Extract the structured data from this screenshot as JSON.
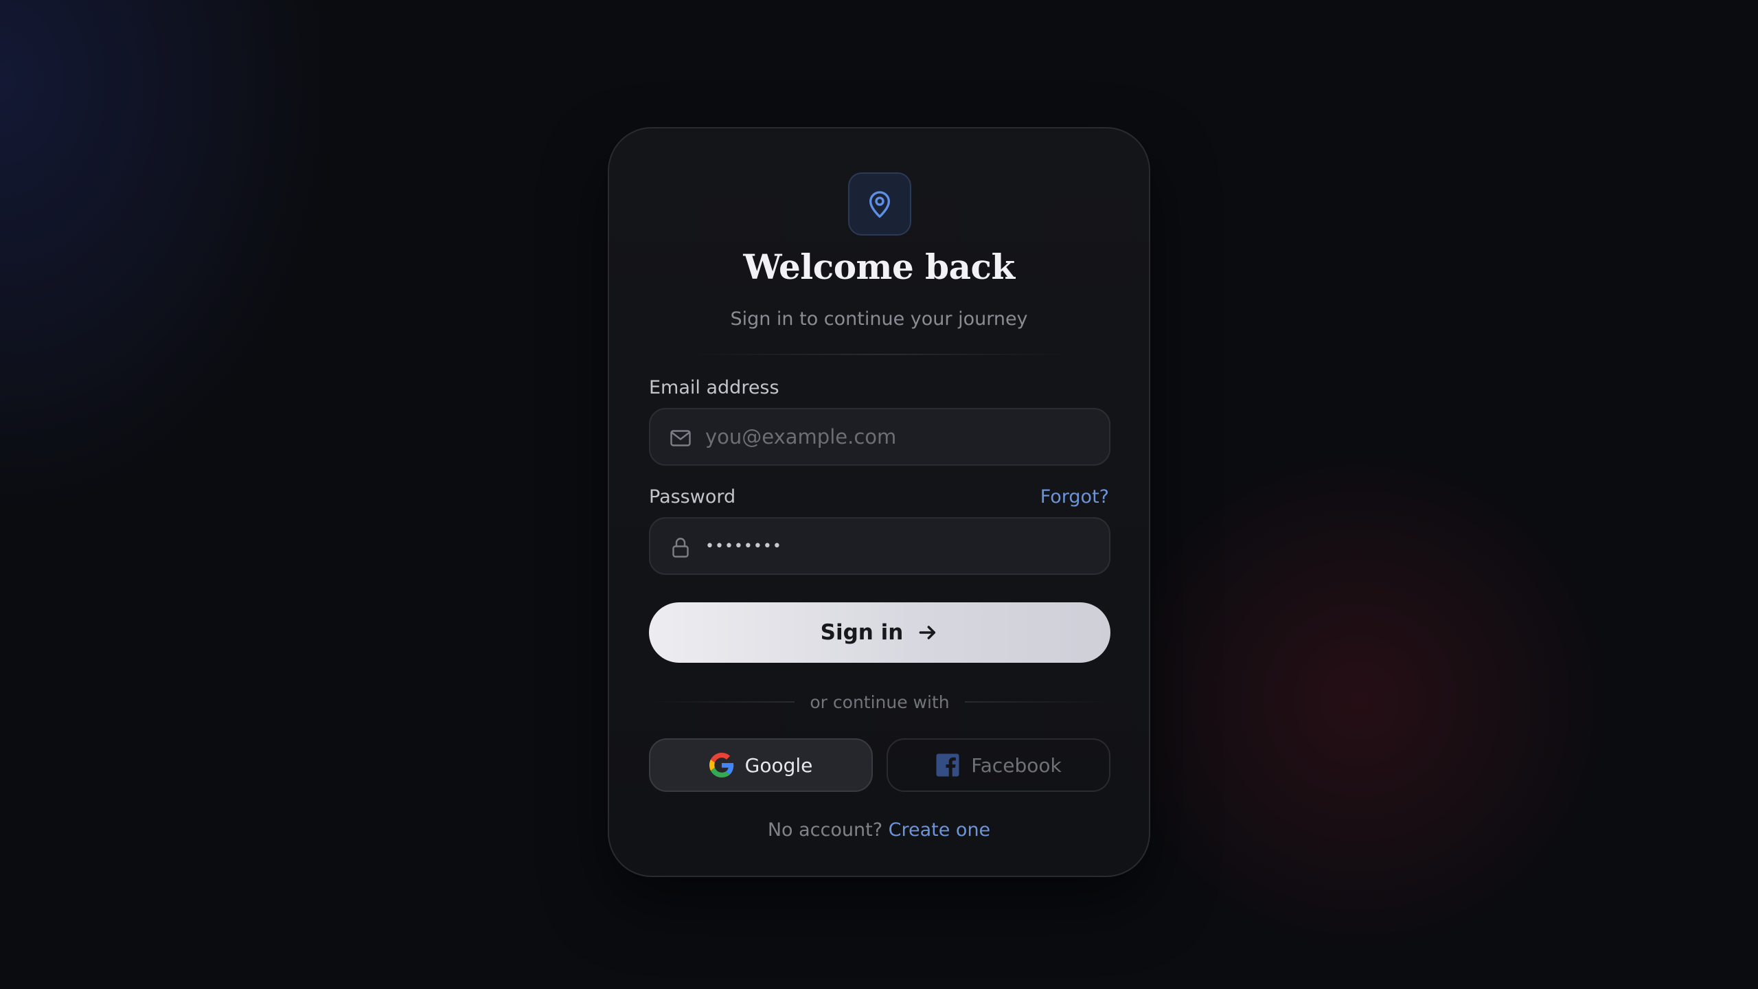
{
  "header": {
    "title": "Welcome back",
    "subtitle": "Sign in to continue your journey"
  },
  "form": {
    "email_label": "Email address",
    "email_placeholder": "you@example.com",
    "password_label": "Password",
    "password_value": "••••••••",
    "forgot_label": "Forgot?",
    "submit_label": "Sign in"
  },
  "social": {
    "divider_label": "or continue with",
    "google_label": "Google",
    "facebook_label": "Facebook"
  },
  "footer": {
    "prompt": "No account?",
    "link_label": "Create one"
  },
  "icons": {
    "logo": "map-pin-icon",
    "email": "mail-icon",
    "password": "lock-icon",
    "submit": "arrow-right-icon",
    "google": "google-logo-icon",
    "facebook": "facebook-logo-icon"
  },
  "colors": {
    "accent": "#6d93d8",
    "background": "#0b0c10",
    "card": "#131418"
  }
}
